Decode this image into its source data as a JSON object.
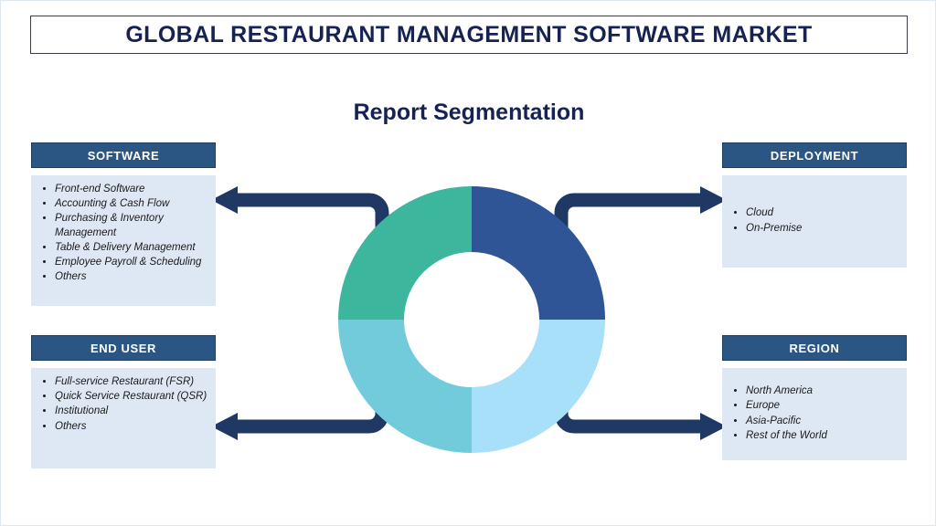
{
  "title": "GLOBAL RESTAURANT MANAGEMENT SOFTWARE MARKET",
  "subtitle": "Report Segmentation",
  "colors": {
    "title_text": "#152252",
    "panel_header_bg": "#2b5583",
    "panel_body_bg": "#dee8f4",
    "arrow": "#1f3864",
    "donut_top_right": "#2f5596",
    "donut_bottom_right": "#a8e0fa",
    "donut_bottom_left": "#71cbda",
    "donut_top_left": "#3cb79e",
    "canvas_border": "#dfe7ef"
  },
  "panels": {
    "software": {
      "header": "SOFTWARE",
      "items": [
        "Front-end Software",
        "Accounting & Cash Flow",
        "Purchasing & Inventory Management",
        "Table & Delivery Management",
        "Employee Payroll & Scheduling",
        "Others"
      ]
    },
    "end_user": {
      "header": "END USER",
      "items": [
        "Full-service Restaurant (FSR)",
        "Quick Service Restaurant (QSR)",
        "Institutional",
        "Others"
      ]
    },
    "deployment": {
      "header": "DEPLOYMENT",
      "items": [
        "Cloud",
        "On-Premise"
      ]
    },
    "region": {
      "header": "REGION",
      "items": [
        "North America",
        "Europe",
        "Asia-Pacific",
        "Rest of the World"
      ]
    }
  },
  "chart_data": {
    "type": "pie",
    "title": "Report Segmentation",
    "subtype": "donut",
    "labels": [
      "Deployment",
      "Region",
      "End User",
      "Software"
    ],
    "values": [
      25,
      25,
      25,
      25
    ],
    "colors": [
      "#2f5596",
      "#a8e0fa",
      "#71cbda",
      "#3cb79e"
    ],
    "legend": "none",
    "notes": "Four equal quadrants; each quadrant connects via an elbow arrow to one segmentation panel."
  }
}
